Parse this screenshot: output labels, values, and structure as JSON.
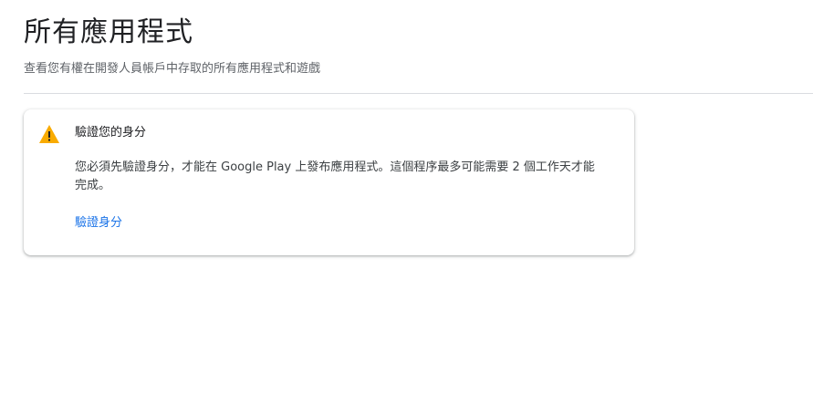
{
  "header": {
    "title": "所有應用程式",
    "subtitle": "查看您有權在開發人員帳戶中存取的所有應用程式和遊戲"
  },
  "notice_card": {
    "icon": "warning-icon",
    "icon_color": "#f9ab00",
    "title": "驗證您的身分",
    "body": "您必須先驗證身分，才能在 Google Play 上發布應用程式。這個程序最多可能需要 2 個工作天才能完成。",
    "link_label": "驗證身分",
    "link_color": "#1a73e8"
  }
}
